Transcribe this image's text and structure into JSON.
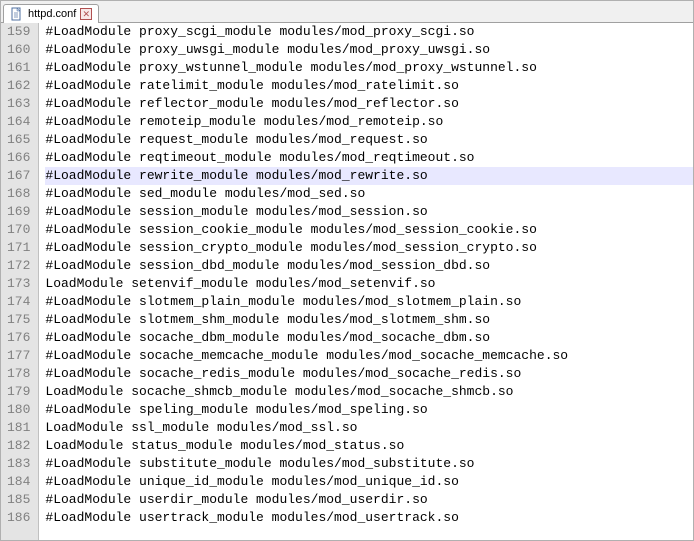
{
  "tab": {
    "filename": "httpd.conf"
  },
  "editor": {
    "highlighted_index": 8,
    "lines": [
      {
        "num": 159,
        "text": "#LoadModule proxy_scgi_module modules/mod_proxy_scgi.so"
      },
      {
        "num": 160,
        "text": "#LoadModule proxy_uwsgi_module modules/mod_proxy_uwsgi.so"
      },
      {
        "num": 161,
        "text": "#LoadModule proxy_wstunnel_module modules/mod_proxy_wstunnel.so"
      },
      {
        "num": 162,
        "text": "#LoadModule ratelimit_module modules/mod_ratelimit.so"
      },
      {
        "num": 163,
        "text": "#LoadModule reflector_module modules/mod_reflector.so"
      },
      {
        "num": 164,
        "text": "#LoadModule remoteip_module modules/mod_remoteip.so"
      },
      {
        "num": 165,
        "text": "#LoadModule request_module modules/mod_request.so"
      },
      {
        "num": 166,
        "text": "#LoadModule reqtimeout_module modules/mod_reqtimeout.so"
      },
      {
        "num": 167,
        "text": "#LoadModule rewrite_module modules/mod_rewrite.so"
      },
      {
        "num": 168,
        "text": "#LoadModule sed_module modules/mod_sed.so"
      },
      {
        "num": 169,
        "text": "#LoadModule session_module modules/mod_session.so"
      },
      {
        "num": 170,
        "text": "#LoadModule session_cookie_module modules/mod_session_cookie.so"
      },
      {
        "num": 171,
        "text": "#LoadModule session_crypto_module modules/mod_session_crypto.so"
      },
      {
        "num": 172,
        "text": "#LoadModule session_dbd_module modules/mod_session_dbd.so"
      },
      {
        "num": 173,
        "text": "LoadModule setenvif_module modules/mod_setenvif.so"
      },
      {
        "num": 174,
        "text": "#LoadModule slotmem_plain_module modules/mod_slotmem_plain.so"
      },
      {
        "num": 175,
        "text": "#LoadModule slotmem_shm_module modules/mod_slotmem_shm.so"
      },
      {
        "num": 176,
        "text": "#LoadModule socache_dbm_module modules/mod_socache_dbm.so"
      },
      {
        "num": 177,
        "text": "#LoadModule socache_memcache_module modules/mod_socache_memcache.so"
      },
      {
        "num": 178,
        "text": "#LoadModule socache_redis_module modules/mod_socache_redis.so"
      },
      {
        "num": 179,
        "text": "LoadModule socache_shmcb_module modules/mod_socache_shmcb.so"
      },
      {
        "num": 180,
        "text": "#LoadModule speling_module modules/mod_speling.so"
      },
      {
        "num": 181,
        "text": "LoadModule ssl_module modules/mod_ssl.so"
      },
      {
        "num": 182,
        "text": "LoadModule status_module modules/mod_status.so"
      },
      {
        "num": 183,
        "text": "#LoadModule substitute_module modules/mod_substitute.so"
      },
      {
        "num": 184,
        "text": "#LoadModule unique_id_module modules/mod_unique_id.so"
      },
      {
        "num": 185,
        "text": "#LoadModule userdir_module modules/mod_userdir.so"
      },
      {
        "num": 186,
        "text": "#LoadModule usertrack_module modules/mod_usertrack.so"
      }
    ]
  }
}
